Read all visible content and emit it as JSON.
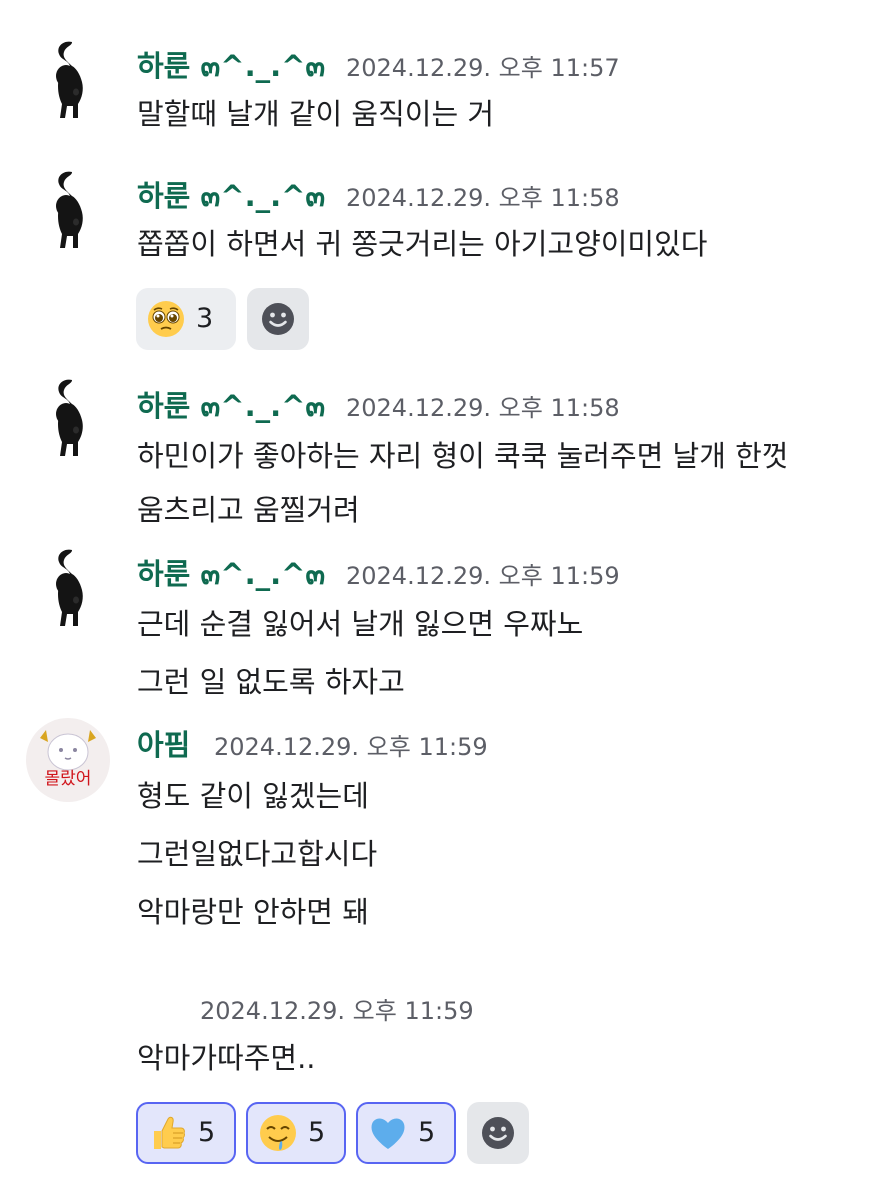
{
  "messages": [
    {
      "author": "하룬 ๓^._.^๓",
      "timestamp": "2024.12.29. 오후 11:57",
      "lines": [
        "말할때 날개 같이 움직이는 거"
      ]
    },
    {
      "author": "하룬 ๓^._.^๓",
      "timestamp": "2024.12.29. 오후 11:58",
      "lines": [
        "쫍쫍이 하면서 귀 쫑긋거리는 아기고양이미있다"
      ],
      "reactions": [
        {
          "emoji": "pleading-face",
          "count": "3"
        }
      ]
    },
    {
      "author": "하룬 ๓^._.^๓",
      "timestamp": "2024.12.29. 오후 11:58",
      "lines": [
        "하민이가 좋아하는 자리 형이 쿡쿡 눌러주면 날개 한껏",
        "움츠리고 움찔거려"
      ]
    },
    {
      "author": "하룬 ๓^._.^๓",
      "timestamp": "2024.12.29. 오후 11:59",
      "lines": [
        "근데 순결 잃어서 날개 잃으면 우짜노",
        "그런 일 없도록 하자고"
      ]
    },
    {
      "author": "아핌",
      "timestamp": "2024.12.29. 오후 11:59",
      "avatar_text": "몰랐어",
      "lines": [
        "형도 같이 잃겠는데",
        "그런일없다고합시다",
        "악마랑만 안하면 돼"
      ]
    },
    {
      "timestamp": "2024.12.29. 오후 11:59",
      "lines": [
        "악마가따주면.."
      ],
      "reactions": [
        {
          "emoji": "thumbs-up",
          "count": "5"
        },
        {
          "emoji": "drooling-face",
          "count": "5"
        },
        {
          "emoji": "blue-heart",
          "count": "5"
        }
      ]
    }
  ],
  "colors": {
    "author_name": "#0f6a50",
    "timestamp": "#5c5e66",
    "reaction_active_border": "#5865f2",
    "reaction_active_bg": "#e3e6fb"
  }
}
